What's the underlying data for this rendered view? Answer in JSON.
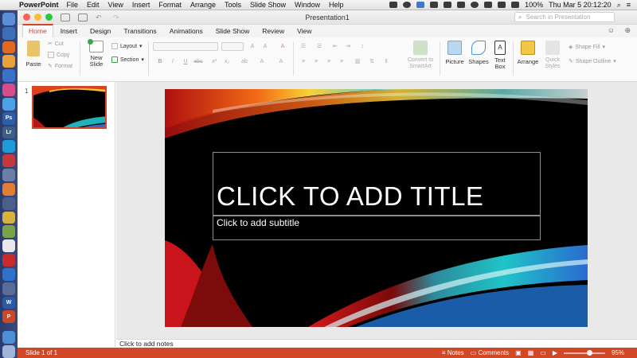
{
  "menubar": {
    "app": "PowerPoint",
    "items": [
      "File",
      "Edit",
      "View",
      "Insert",
      "Format",
      "Arrange",
      "Tools",
      "Slide Show",
      "Window",
      "Help"
    ],
    "battery": "100%",
    "clock": "Thu Mar 5  20:12:20"
  },
  "window": {
    "title": "Presentation1",
    "search_placeholder": "Search in Presentation"
  },
  "tabs": [
    "Home",
    "Insert",
    "Design",
    "Transitions",
    "Animations",
    "Slide Show",
    "Review",
    "View"
  ],
  "ribbon": {
    "paste": "Paste",
    "cut": "Cut",
    "copy": "Copy",
    "format": "Format",
    "new_slide": "New\nSlide",
    "layout": "Layout",
    "section": "Section",
    "convert_smartart": "Convert to\nSmartArt",
    "picture": "Picture",
    "shapes": "Shapes",
    "text_box": "Text\nBox",
    "arrange": "Arrange",
    "quick_styles": "Quick\nStyles",
    "shape_fill": "Shape Fill",
    "shape_outline": "Shape Outline"
  },
  "slides_pane": {
    "slide_number": "1"
  },
  "slide": {
    "title_placeholder": "CLICK TO ADD TITLE",
    "subtitle_placeholder": "Click to add subtitle"
  },
  "notes": {
    "placeholder": "Click to add notes"
  },
  "status": {
    "slide_info": "Slide 1 of 1",
    "notes": "Notes",
    "comments": "Comments",
    "zoom": "95%",
    "zoom_level": 0.62
  },
  "colors": {
    "accent": "#d24726",
    "slide_bg": "#000000"
  }
}
